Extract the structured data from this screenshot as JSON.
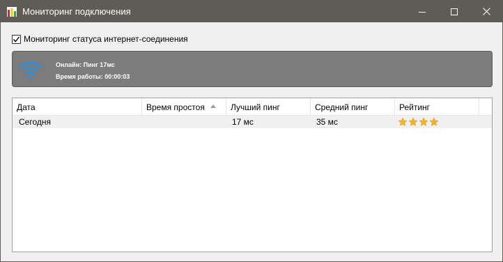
{
  "window": {
    "title": "Мониторинг подключения"
  },
  "monitor": {
    "checkbox_label": "Мониторинг статуса интернет-соединения",
    "checked": true
  },
  "status": {
    "line1": "Онлайн: Пинг 17мс",
    "line2": "Время работы: 00:00:03",
    "icon": "wifi-icon",
    "icon_color": "#2f8fdc"
  },
  "table": {
    "columns": [
      "Дата",
      "Время простоя",
      "Лучший пинг",
      "Средний пинг",
      "Рейтинг"
    ],
    "sorted_column": "Время простоя",
    "sort_direction": "ascending",
    "rows": [
      {
        "date": "Сегодня",
        "downtime": "",
        "best_ping": "17 мс",
        "avg_ping": "35 мс",
        "rating": 4
      }
    ]
  },
  "colors": {
    "titlebar": "#5f5b57",
    "status_panel": "#7c7c7c",
    "star": "#f0b429"
  }
}
